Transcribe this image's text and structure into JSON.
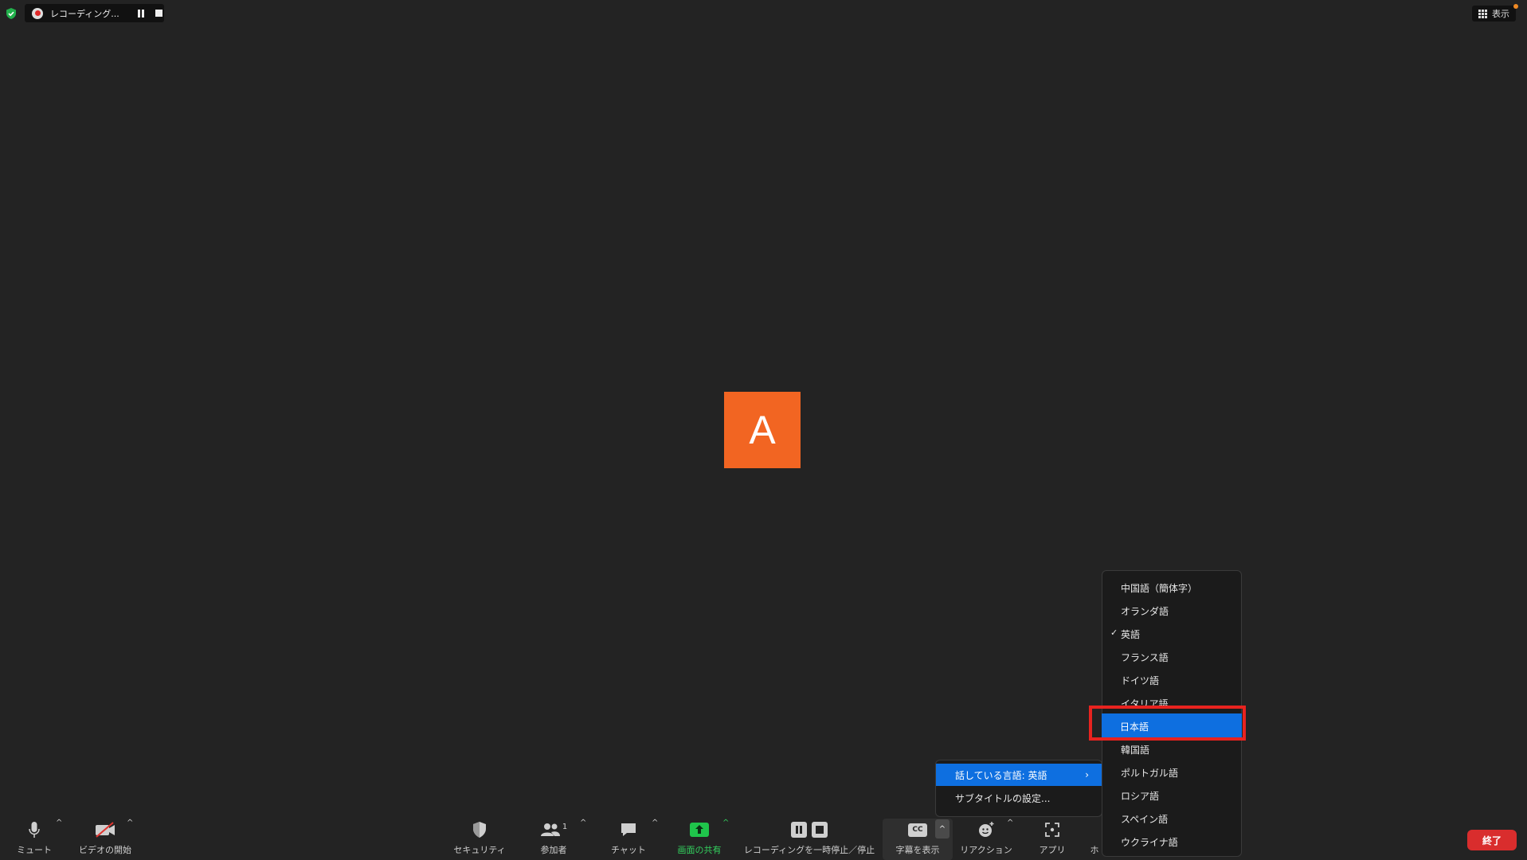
{
  "status": {
    "recording_label": "レコーディング...",
    "view_label": "表示"
  },
  "avatar": {
    "initial": "A",
    "color": "#f26522"
  },
  "toolbar": {
    "mute": "ミュート",
    "video": "ビデオの開始",
    "security": "セキュリティ",
    "participants": "参加者",
    "participants_count": "1",
    "chat": "チャット",
    "share": "画面の共有",
    "recording": "レコーディングを一時停止／停止",
    "cc_badge": "CC",
    "captions": "字幕を表示",
    "reactions": "リアクション",
    "apps": "アプリ",
    "more": "ホ",
    "end": "終了"
  },
  "caption_menu": {
    "items": [
      {
        "label": "話している言語: 英語",
        "selected": true,
        "has_submenu": true
      },
      {
        "label": "サブタイトルの設定...",
        "selected": false
      }
    ]
  },
  "language_menu": {
    "items": [
      "中国語（簡体字）",
      "オランダ語",
      "英語",
      "フランス語",
      "ドイツ語",
      "イタリア語",
      "日本語",
      "韓国語",
      "ポルトガル語",
      "ロシア語",
      "スペイン語",
      "ウクライナ語"
    ],
    "checked": "英語",
    "highlighted": "日本語"
  },
  "colors": {
    "background": "#232323",
    "accent": "#0e6fe0",
    "end_button": "#d92d2d",
    "share_green": "#33d25f",
    "highlight_box": "#e8231f"
  }
}
